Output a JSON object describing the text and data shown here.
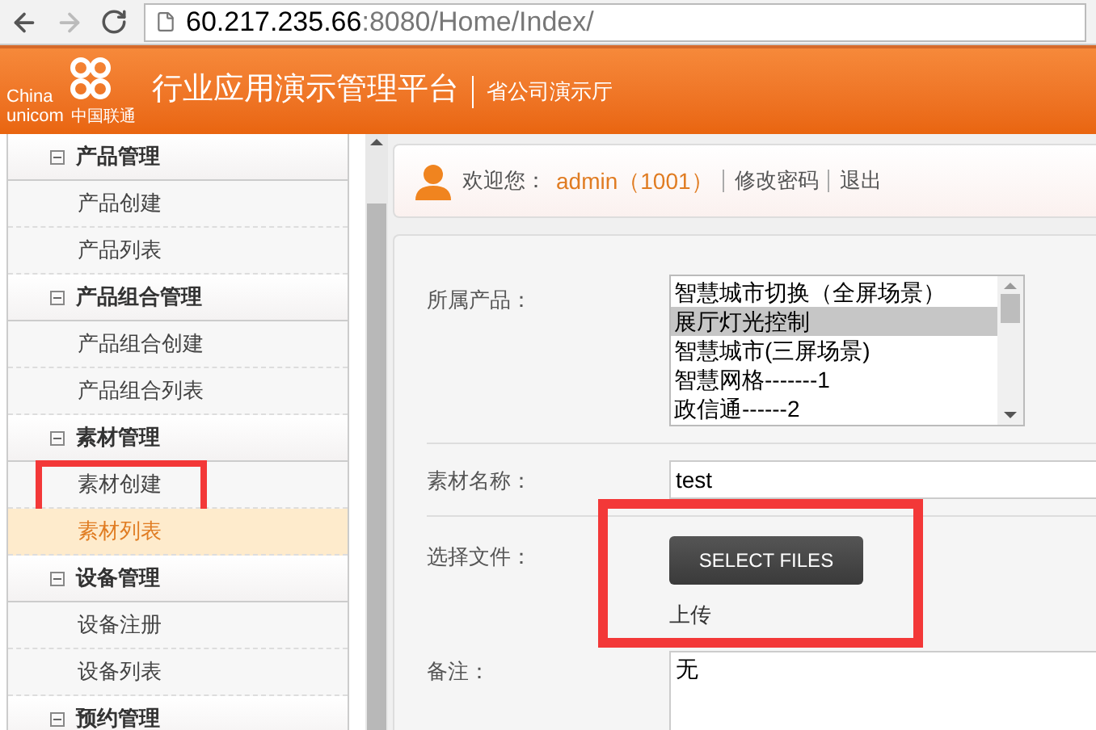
{
  "browser": {
    "url_host": "60.217.235.66",
    "url_rest": ":8080/Home/Index/"
  },
  "header": {
    "logo_line1": "China",
    "logo_line2": "unicom",
    "logo_cn": "中国联通",
    "title": "行业应用演示管理平台",
    "subtitle": "省公司演示厅"
  },
  "sidebar": {
    "groups": [
      {
        "label": "产品管理",
        "expanded": true,
        "items": [
          {
            "label": "产品创建",
            "selected": false,
            "highlighted": false
          },
          {
            "label": "产品列表",
            "selected": false,
            "highlighted": false
          }
        ]
      },
      {
        "label": "产品组合管理",
        "expanded": true,
        "items": [
          {
            "label": "产品组合创建",
            "selected": false,
            "highlighted": false
          },
          {
            "label": "产品组合列表",
            "selected": false,
            "highlighted": false
          }
        ]
      },
      {
        "label": "素材管理",
        "expanded": true,
        "items": [
          {
            "label": "素材创建",
            "selected": false,
            "highlighted": true
          },
          {
            "label": "素材列表",
            "selected": true,
            "highlighted": false
          }
        ]
      },
      {
        "label": "设备管理",
        "expanded": true,
        "items": [
          {
            "label": "设备注册",
            "selected": false,
            "highlighted": false
          },
          {
            "label": "设备列表",
            "selected": false,
            "highlighted": false
          }
        ]
      },
      {
        "label": "预约管理",
        "expanded": true
      }
    ]
  },
  "user_bar": {
    "greeting": "欢迎您：",
    "user": "admin（1001）",
    "links": [
      "修改密码",
      "退出"
    ]
  },
  "form": {
    "product_label": "所属产品：",
    "product_options": [
      {
        "label": "智慧城市切换（全屏场景）",
        "selected": false
      },
      {
        "label": "展厅灯光控制",
        "selected": true
      },
      {
        "label": "智慧城市(三屏场景)",
        "selected": false
      },
      {
        "label": "智慧网格-------1",
        "selected": false
      },
      {
        "label": "政信通------2",
        "selected": false
      }
    ],
    "name_label": "素材名称：",
    "name_value": "test",
    "file_label": "选择文件：",
    "file_button": "SELECT FILES",
    "upload_link": "上传",
    "file_highlighted": true,
    "remark_label": "备注：",
    "remark_value": "无"
  }
}
